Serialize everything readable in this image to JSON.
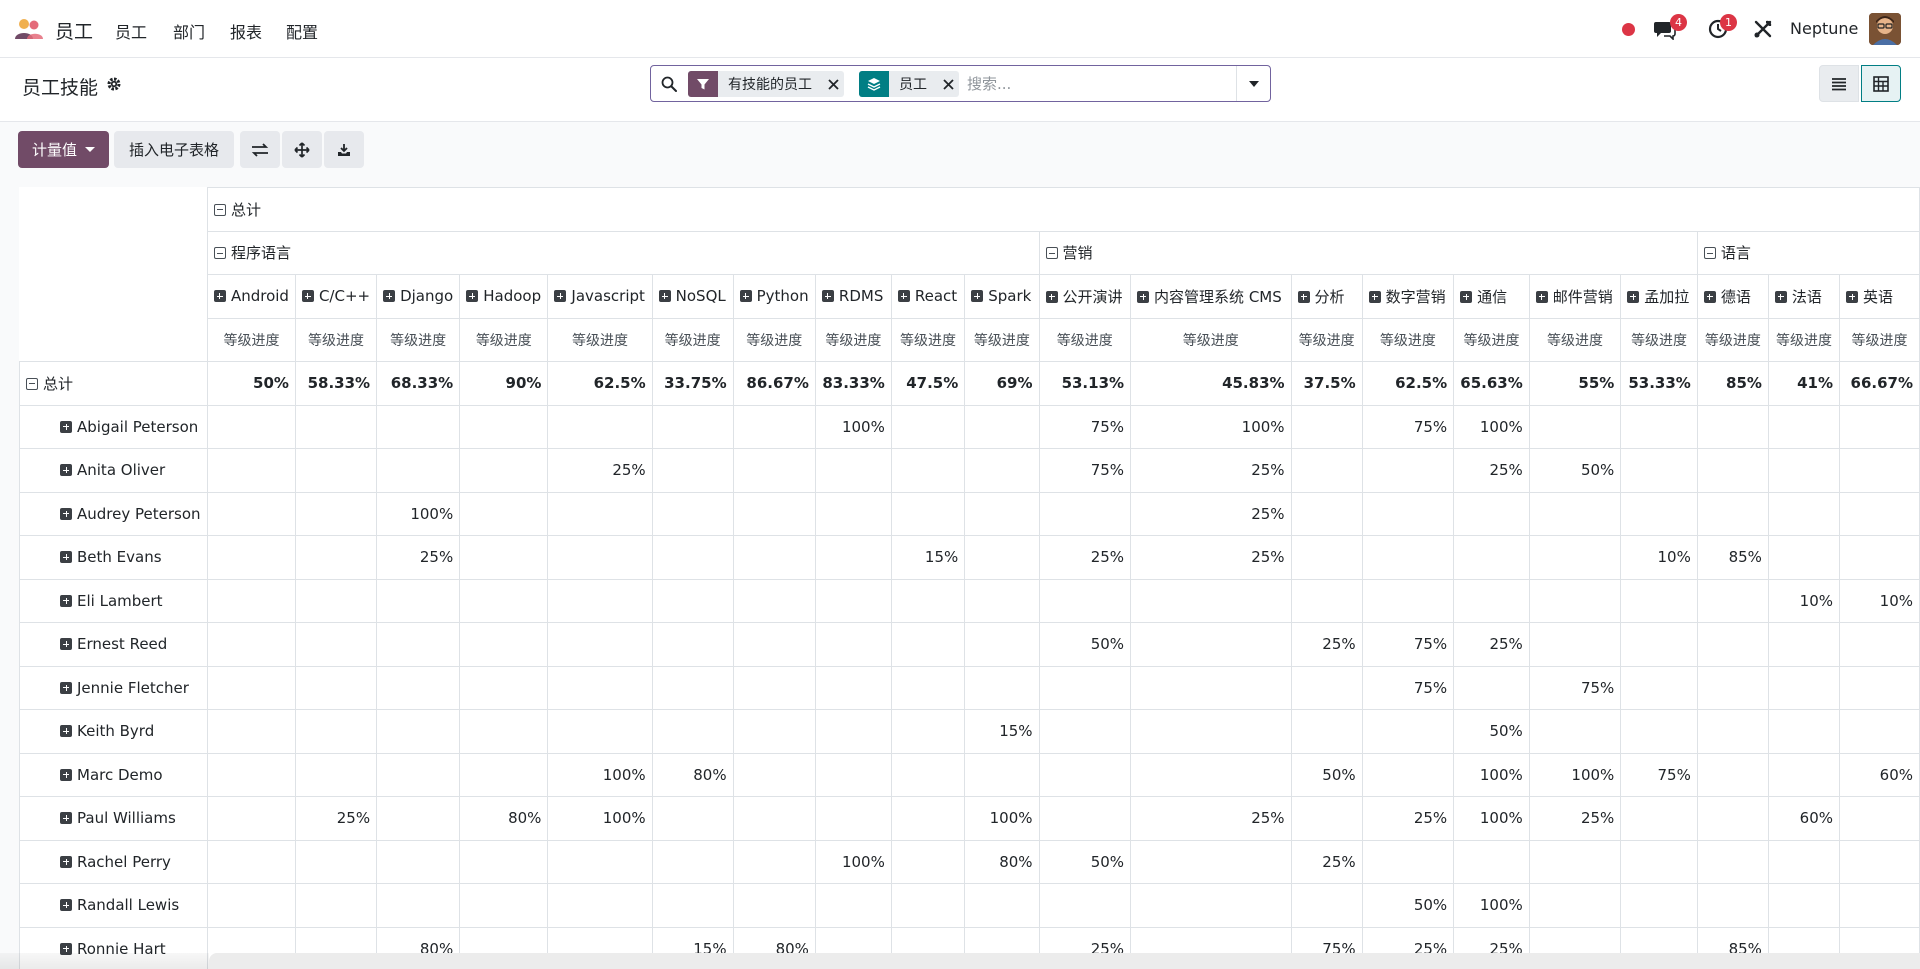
{
  "navbar": {
    "app_name": "员工",
    "menu": [
      "员工",
      "部门",
      "报表",
      "配置"
    ],
    "messages_count": "4",
    "activities_count": "1",
    "company": "Neptune"
  },
  "control_panel": {
    "title": "员工技能",
    "facets": [
      {
        "label": "有技能的员工",
        "icon": "filter-icon",
        "color": "#714b67"
      },
      {
        "label": "员工",
        "icon": "layers-icon",
        "color": "#017e84"
      }
    ],
    "search_placeholder": "搜索..."
  },
  "toolbar": {
    "measures_label": "计量值",
    "insert_spreadsheet_label": "插入电子表格"
  },
  "pivot": {
    "total_label": "总计",
    "measure_label": "等级进度",
    "groups": [
      {
        "label": "程序语言",
        "span": 10
      },
      {
        "label": "营销",
        "span": 7
      },
      {
        "label": "语言",
        "span": 4
      }
    ],
    "columns": [
      "Android",
      "C/C++",
      "Django",
      "Hadoop",
      "Javascript",
      "NoSQL",
      "Python",
      "RDMS",
      "React",
      "Spark",
      "公开演讲",
      "内容管理系统 CMS",
      "分析",
      "数字营销",
      "通信",
      "邮件营销",
      "孟加拉",
      "德语",
      "法语",
      "英语"
    ],
    "totals": [
      "50%",
      "58.33%",
      "68.33%",
      "90%",
      "62.5%",
      "33.75%",
      "86.67%",
      "83.33%",
      "47.5%",
      "69%",
      "53.13%",
      "45.83%",
      "37.5%",
      "62.5%",
      "65.63%",
      "55%",
      "53.33%",
      "85%",
      "41%",
      "66.67%"
    ],
    "rows": [
      {
        "name": "Abigail Peterson",
        "values": [
          "",
          "",
          "",
          "",
          "",
          "",
          "",
          "100%",
          "",
          "",
          "75%",
          "100%",
          "",
          "75%",
          "100%",
          "",
          "",
          "",
          "",
          ""
        ]
      },
      {
        "name": "Anita Oliver",
        "values": [
          "",
          "",
          "",
          "",
          "25%",
          "",
          "",
          "",
          "",
          "",
          "75%",
          "25%",
          "",
          "",
          "25%",
          "50%",
          "",
          "",
          "",
          ""
        ]
      },
      {
        "name": "Audrey Peterson",
        "values": [
          "",
          "",
          "100%",
          "",
          "",
          "",
          "",
          "",
          "",
          "",
          "",
          "25%",
          "",
          "",
          "",
          "",
          "",
          "",
          "",
          ""
        ]
      },
      {
        "name": "Beth Evans",
        "values": [
          "",
          "",
          "25%",
          "",
          "",
          "",
          "",
          "",
          "15%",
          "",
          "25%",
          "25%",
          "",
          "",
          "",
          "",
          "10%",
          "85%",
          "",
          ""
        ]
      },
      {
        "name": "Eli Lambert",
        "values": [
          "",
          "",
          "",
          "",
          "",
          "",
          "",
          "",
          "",
          "",
          "",
          "",
          "",
          "",
          "",
          "",
          "",
          "",
          "10%",
          "10%"
        ]
      },
      {
        "name": "Ernest Reed",
        "values": [
          "",
          "",
          "",
          "",
          "",
          "",
          "",
          "",
          "",
          "",
          "50%",
          "",
          "25%",
          "75%",
          "25%",
          "",
          "",
          "",
          "",
          ""
        ]
      },
      {
        "name": "Jennie Fletcher",
        "values": [
          "",
          "",
          "",
          "",
          "",
          "",
          "",
          "",
          "",
          "",
          "",
          "",
          "",
          "75%",
          "",
          "75%",
          "",
          "",
          "",
          ""
        ]
      },
      {
        "name": "Keith Byrd",
        "values": [
          "",
          "",
          "",
          "",
          "",
          "",
          "",
          "",
          "",
          "15%",
          "",
          "",
          "",
          "",
          "50%",
          "",
          "",
          "",
          "",
          ""
        ]
      },
      {
        "name": "Marc Demo",
        "values": [
          "",
          "",
          "",
          "",
          "100%",
          "80%",
          "",
          "",
          "",
          "",
          "",
          "",
          "50%",
          "",
          "100%",
          "100%",
          "75%",
          "",
          "",
          "60%"
        ]
      },
      {
        "name": "Paul Williams",
        "values": [
          "",
          "25%",
          "",
          "80%",
          "100%",
          "",
          "",
          "",
          "",
          "100%",
          "",
          "25%",
          "",
          "25%",
          "100%",
          "25%",
          "",
          "",
          "60%",
          ""
        ]
      },
      {
        "name": "Rachel Perry",
        "values": [
          "",
          "",
          "",
          "",
          "",
          "",
          "",
          "100%",
          "",
          "80%",
          "50%",
          "",
          "25%",
          "",
          "",
          "",
          "",
          "",
          "",
          ""
        ]
      },
      {
        "name": "Randall Lewis",
        "values": [
          "",
          "",
          "",
          "",
          "",
          "",
          "",
          "",
          "",
          "",
          "",
          "",
          "",
          "50%",
          "100%",
          "",
          "",
          "",
          "",
          ""
        ]
      },
      {
        "name": "Ronnie Hart",
        "values": [
          "",
          "",
          "80%",
          "",
          "",
          "15%",
          "80%",
          "",
          "",
          "",
          "25%",
          "",
          "75%",
          "25%",
          "25%",
          "",
          "",
          "85%",
          "",
          ""
        ]
      }
    ]
  }
}
